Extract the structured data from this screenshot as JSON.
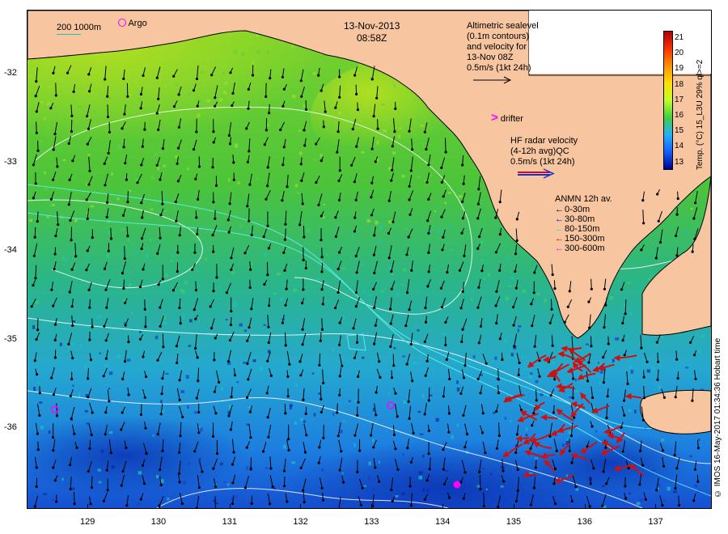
{
  "map": {
    "date": "13-Nov-2013",
    "time": "08:58Z",
    "scale_bar": {
      "label_200": "200",
      "label_1000": "1000m"
    },
    "argo_label": "Argo",
    "altimetry": {
      "lines": [
        "Altimetric sealevel",
        "(0.1m contours)",
        "and velocity for",
        "13-Nov 08Z",
        "0.5m/s (1kt 24h)"
      ]
    },
    "drifter_label": "drifter",
    "hf_radar": {
      "lines": [
        "HF radar velocity",
        "(4-12h avg)QC",
        "0.5m/s (1kt 24h)"
      ]
    },
    "anmn": {
      "title": "ANMN 12h av.",
      "items": [
        {
          "label": "0-30m",
          "color": "#000000"
        },
        {
          "label": "30-80m",
          "color": "#0000ff"
        },
        {
          "label": "80-150m",
          "color": "#00e5e5"
        },
        {
          "label": "150-300m",
          "color": "#e00000"
        },
        {
          "label": "300-600m",
          "color": "#ff00ff"
        }
      ]
    },
    "colorbar": {
      "title": "Temp. (°C) 15_L3U 29% ql>=2",
      "ticks": [
        "21",
        "20",
        "19",
        "18",
        "17",
        "16",
        "15",
        "14",
        "13"
      ],
      "colors": [
        "#b00000",
        "#ff3000",
        "#ff9000",
        "#ffe000",
        "#c0ff20",
        "#40d040",
        "#20b0ff",
        "#1060ff",
        "#000090"
      ]
    },
    "x_ticks": [
      "129",
      "130",
      "131",
      "132",
      "133",
      "134",
      "135",
      "136",
      "137"
    ],
    "y_ticks": [
      "-32",
      "-33",
      "-34",
      "-35",
      "-36"
    ],
    "credit": "© IMOS 16-May-2017 01:34:36 Hobart time",
    "colors": {
      "land": "#f7c59f",
      "argo": "#ff00ff",
      "hf_arrow": "#d01010",
      "contour": "#ffffff"
    }
  }
}
